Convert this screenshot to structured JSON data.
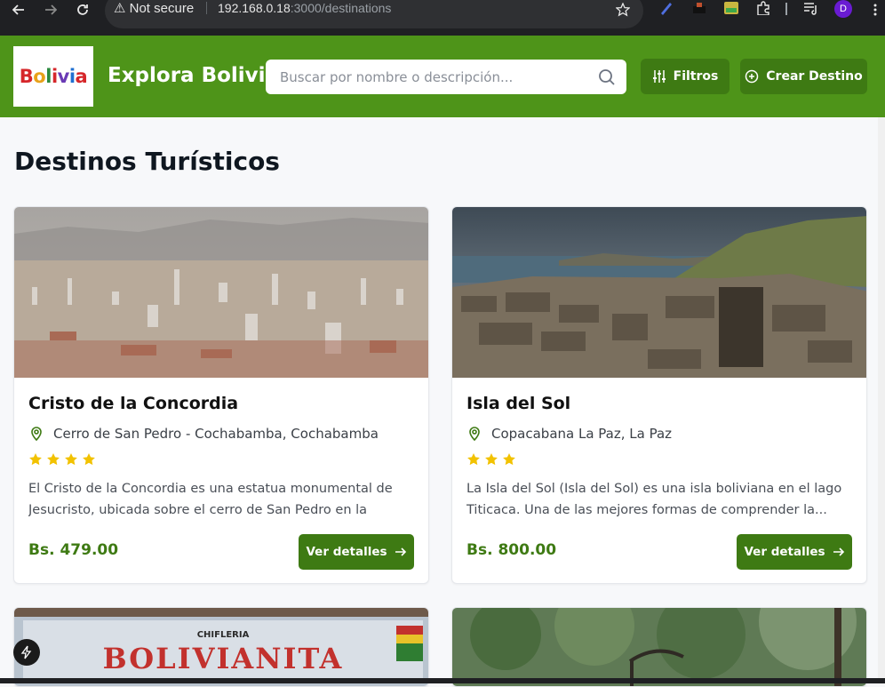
{
  "browser": {
    "security_label": "Not secure",
    "url_host": "192.168.0.18",
    "url_path": ":3000/destinations",
    "profile_initial": "D"
  },
  "header": {
    "logo_text": "Bolivia",
    "brand": "Explora Bolivia",
    "search_placeholder": "Buscar por nombre o descripción...",
    "filter_label": "Filtros",
    "create_label": "Crear Destino",
    "colors": {
      "header_bg": "#4e9419",
      "button_bg": "#3e7a13"
    }
  },
  "page": {
    "title": "Destinos Turísticos"
  },
  "destinations": [
    {
      "title": "Cristo de la Concordia",
      "location": "Cerro de San Pedro - Cochabamba, Cochabamba",
      "rating": 4,
      "description": "El Cristo de la Concordia es una estatua monumental de Jesucristo, ubicada sobre el cerro de San Pedro en la ciudad...",
      "price": "Bs. 479.00",
      "details_label": "Ver detalles"
    },
    {
      "title": "Isla del Sol",
      "location": "Copacabana La Paz, La Paz",
      "rating": 3,
      "description": "La Isla del Sol (Isla del Sol) es una isla boliviana en el lago Titicaca. Una de las mejores formas de comprender la...",
      "price": "Bs. 800.00",
      "details_label": "Ver detalles"
    }
  ],
  "partial_cards": [
    {
      "banner_text": "BOLIVIANITA",
      "sub_text": "CHIFLERIA"
    }
  ]
}
